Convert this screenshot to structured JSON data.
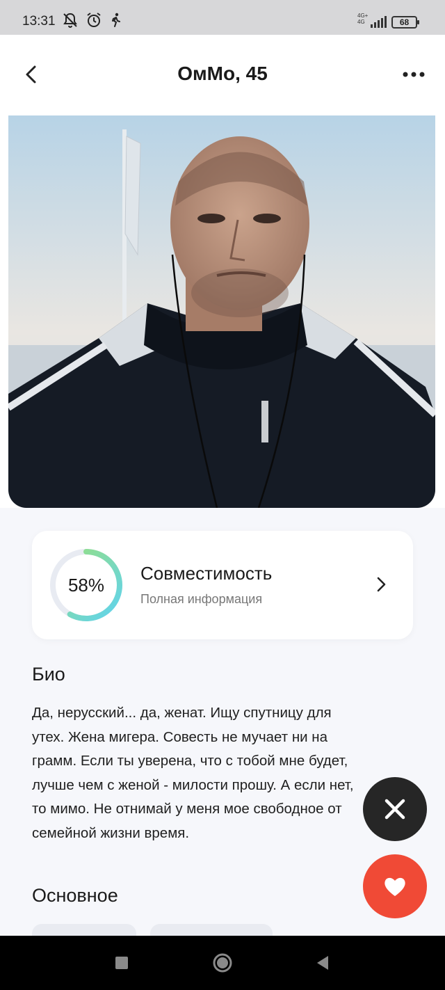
{
  "status_bar": {
    "time": "13:31",
    "network_top": "4G+",
    "network_bottom": "4G",
    "battery": "68",
    "icons": [
      "muted-bell-icon",
      "alarm-icon",
      "walking-icon",
      "signal-icon",
      "battery-icon"
    ]
  },
  "header": {
    "title": "ОмМо, 45"
  },
  "compatibility": {
    "percent_label": "58%",
    "percent_value": 58,
    "title": "Совместимость",
    "subtitle": "Полная информация"
  },
  "bio": {
    "heading": "Био",
    "lines": [
      "Да, нерусский... да, женат. Ищу спутницу для",
      "утех. Жена мигера. Совесть не мучает ни на",
      "грамм.  Если ты уверена, что с тобой мне будет,",
      "лучше чем с женой - милости прошу. А если нет,",
      "то мимо. Не отнимай у меня мое свободное от",
      "семейной жизни время."
    ]
  },
  "basics": {
    "heading": "Основное"
  },
  "colors": {
    "accent_red": "#f04a36",
    "dark_button": "#262626",
    "ring_gradient_start": "#5fd3f0",
    "ring_gradient_end": "#9be07a",
    "ring_track": "#e8ebf2"
  }
}
